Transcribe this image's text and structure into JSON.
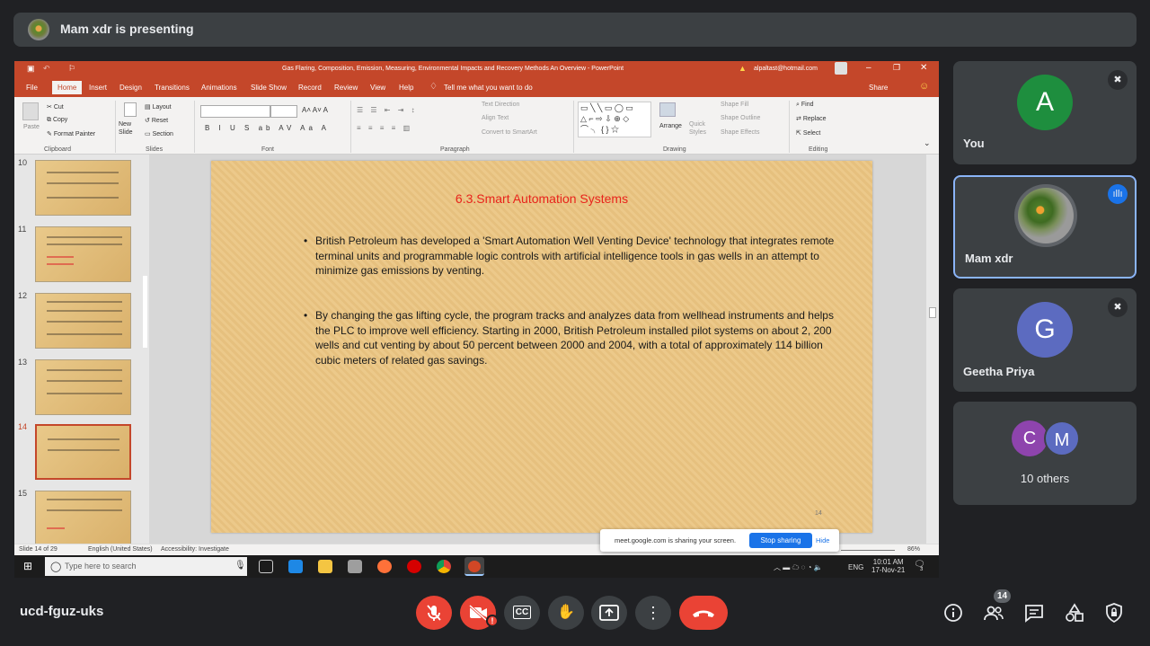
{
  "presenting": {
    "text": "Mam xdr is presenting"
  },
  "ppt": {
    "window_title": "Gas Flaring, Composition, Emission, Measuring, Environmental Impacts and Recovery Methods An Overview - PowerPoint",
    "account": "alpaltast@hotmail.com",
    "tabs": [
      "File",
      "Home",
      "Insert",
      "Design",
      "Transitions",
      "Animations",
      "Slide Show",
      "Record",
      "Review",
      "View",
      "Help"
    ],
    "tell_me": "Tell me what you want to do",
    "share": "Share",
    "ribbon": {
      "paste": "Paste",
      "cut": "Cut",
      "copy": "Copy",
      "format_painter": "Format Painter",
      "new_slide": "New Slide",
      "layout": "Layout",
      "reset": "Reset",
      "section": "Section",
      "text_direction": "Text Direction",
      "align_text": "Align Text",
      "convert_smartart": "Convert to SmartArt",
      "arrange": "Arrange",
      "quick_styles": "Quick Styles",
      "shape_fill": "Shape Fill",
      "shape_outline": "Shape Outline",
      "shape_effects": "Shape Effects",
      "find": "Find",
      "replace": "Replace",
      "select": "Select",
      "groups": [
        "Clipboard",
        "Slides",
        "Font",
        "Paragraph",
        "Drawing",
        "Editing"
      ]
    },
    "thumbnails": [
      "10",
      "11",
      "12",
      "13",
      "14",
      "15"
    ],
    "slide": {
      "title": "6.3.Smart Automation Systems",
      "bullets": [
        "British Petroleum has developed a 'Smart Automation Well Venting Device' technology that integrates remote terminal units and programmable logic controls with artificial intelligence tools in gas wells in an attempt to minimize gas emissions by venting.",
        "By changing the gas lifting cycle, the program tracks and analyzes data from wellhead instruments and helps the PLC to improve well efficiency. Starting in 2000, British Petroleum installed pilot systems on about 2, 200 wells and cut venting by about 50 percent between 2000 and 2004, with a total of approximately 114 billion cubic meters of related gas savings."
      ],
      "number": "14"
    },
    "status": {
      "slide": "Slide 14 of 29",
      "language": "English (United States)",
      "accessibility": "Accessibility: Investigate",
      "zoom": "86%"
    },
    "share_banner": {
      "text": "meet.google.com is sharing your screen.",
      "stop": "Stop sharing",
      "hide": "Hide"
    },
    "taskbar": {
      "search": "Type here to search",
      "lang": "ENG",
      "time": "10:01 AM",
      "date": "17-Nov-21",
      "notif": "3"
    }
  },
  "participants": [
    {
      "name": "You",
      "initial": "A",
      "color": "#1e8e3e"
    },
    {
      "name": "Mam xdr"
    },
    {
      "name": "Geetha Priya",
      "initial": "G",
      "color": "#5c6bc0"
    },
    {
      "name": "10 others",
      "initials": [
        "C",
        "M"
      ],
      "colors": [
        "#8e44ad",
        "#5c6bc0"
      ]
    }
  ],
  "bottom": {
    "meeting_code": "ucd-fguz-uks",
    "people_count": "14"
  }
}
